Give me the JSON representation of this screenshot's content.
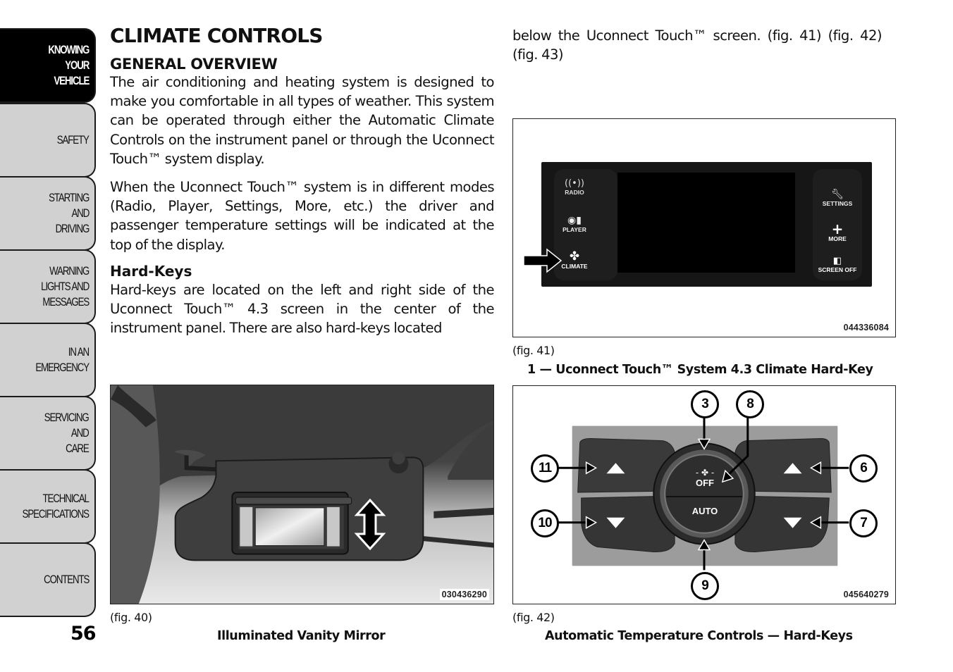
{
  "sidebar": {
    "tabs": [
      {
        "label": "KNOWING\nYOUR\nVEHICLE",
        "active": true
      },
      {
        "label": "SAFETY",
        "active": false
      },
      {
        "label": "STARTING\nAND\nDRIVING",
        "active": false
      },
      {
        "label": "WARNING\nLIGHTS AND\nMESSAGES",
        "active": false
      },
      {
        "label": "IN AN\nEMERGENCY",
        "active": false
      },
      {
        "label": "SERVICING\nAND\nCARE",
        "active": false
      },
      {
        "label": "TECHNICAL\nSPECIFICATIONS",
        "active": false
      },
      {
        "label": "CONTENTS",
        "active": false
      }
    ],
    "page_number": "56"
  },
  "content": {
    "title": "CLIMATE CONTROLS",
    "section": "GENERAL OVERVIEW",
    "para1": "The air conditioning and heating system is designed to make you comfortable in all types of weather. This system can be operated through either the Automatic Climate Controls on the instrument panel or through the Uconnect Touch™ system display.",
    "para2": "When the Uconnect Touch™ system is in different modes (Radio, Player, Settings, More, etc.) the driver and passenger temperature settings will be indicated at the top of the display.",
    "subsection": "Hard-Keys",
    "para3": "Hard-keys are located on the left and right side of the Uconnect Touch™ 4.3 screen in the center of the instrument panel. There are also hard-keys located",
    "para3_cont": "below the Uconnect Touch™ screen. (fig. 41) (fig. 42) (fig. 43)"
  },
  "figures": {
    "fig40": {
      "ref": "(fig. 40)",
      "caption": "Illuminated Vanity Mirror",
      "code": "030436290"
    },
    "fig41": {
      "ref": "(fig. 41)",
      "caption": "1 — Uconnect Touch™ System 4.3 Climate Hard-Key",
      "code": "044336084",
      "left_keys": [
        "RADIO",
        "PLAYER",
        "CLIMATE"
      ],
      "right_keys": [
        "SETTINGS",
        "MORE",
        "SCREEN OFF"
      ]
    },
    "fig42": {
      "ref": "(fig. 42)",
      "caption": "Automatic Temperature Controls — Hard-Keys",
      "code": "045640279",
      "dial_top_label": "OFF",
      "dial_bottom_label": "AUTO",
      "callouts": [
        "3",
        "8",
        "11",
        "6",
        "10",
        "7",
        "9"
      ]
    }
  }
}
